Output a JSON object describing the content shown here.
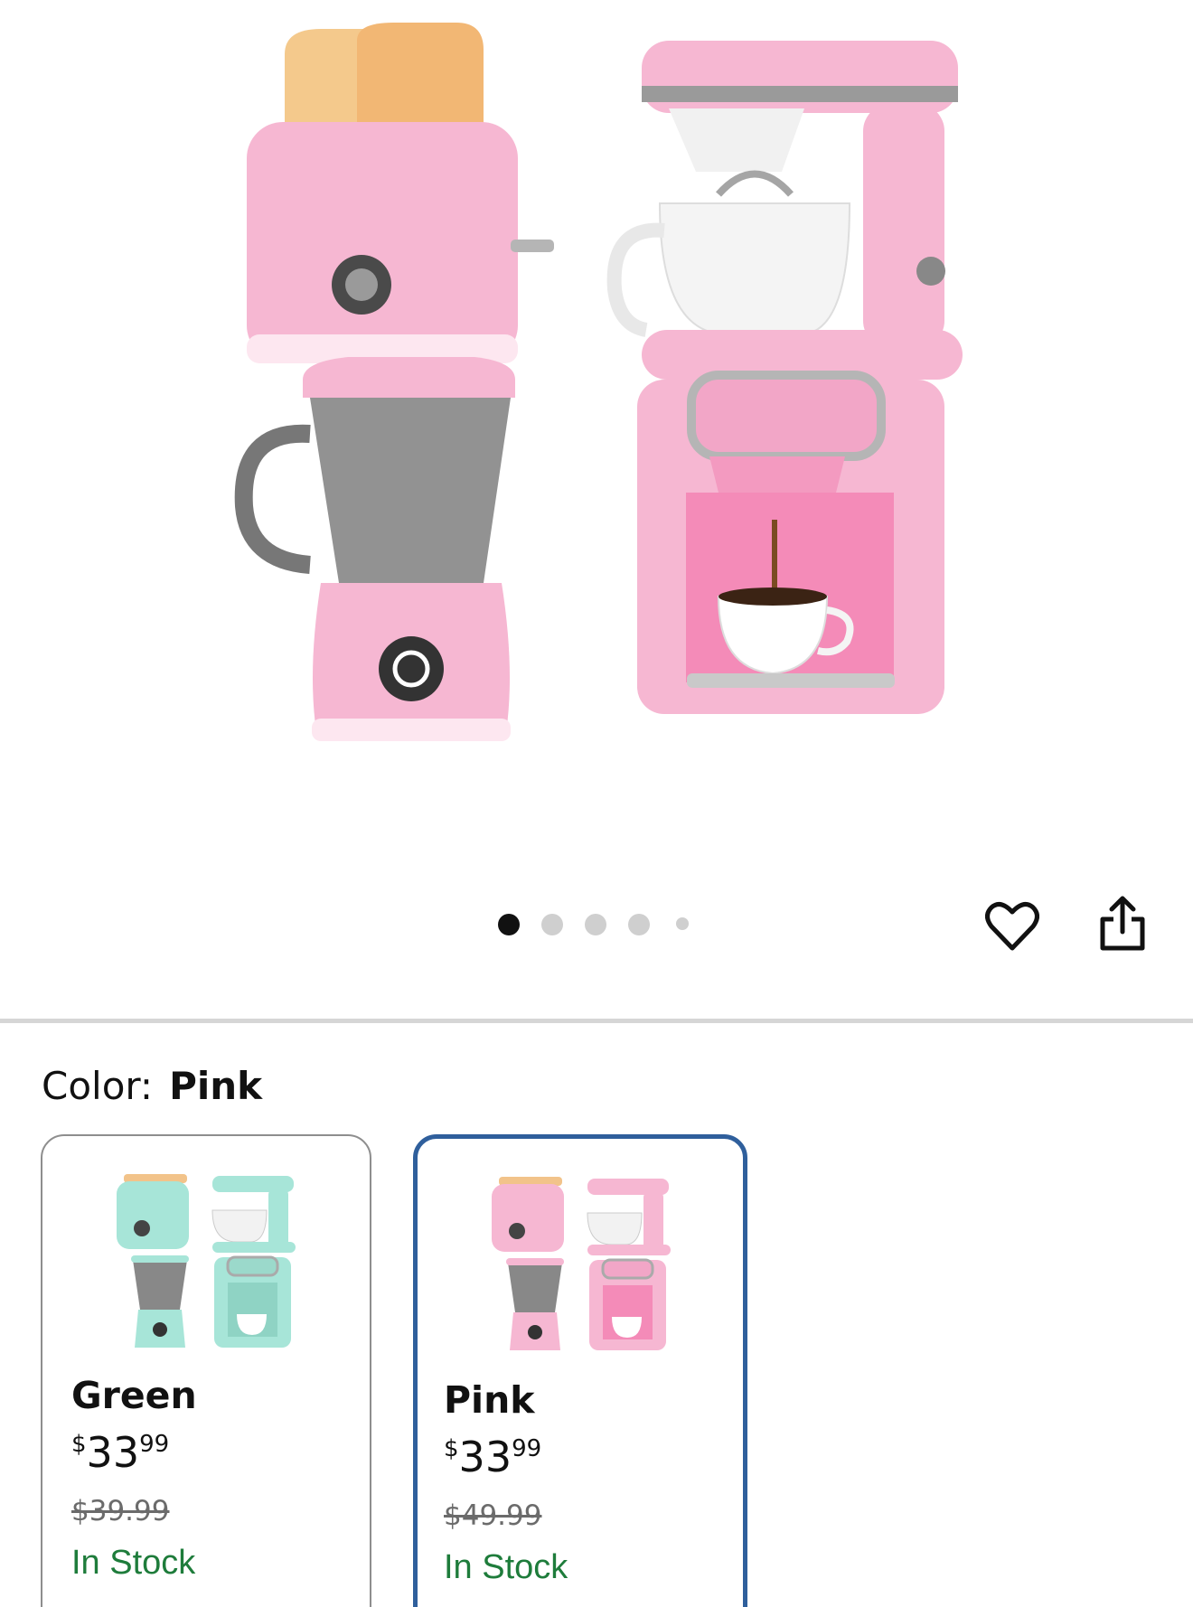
{
  "product_image": {
    "alt_icon": "kitchen-toys-photo",
    "accent": "#f6b7d2"
  },
  "carousel": {
    "total_dots": 5,
    "active_index": 0
  },
  "actions": {
    "favorite_icon": "heart-outline-icon",
    "share_icon": "share-icon"
  },
  "color_selector": {
    "label": "Color:",
    "selected": "Pink",
    "options": [
      {
        "name": "Green",
        "currency": "$",
        "whole": "33",
        "cents": "99",
        "old_price": "$39.99",
        "stock": "In Stock",
        "swatch_color": "#a7e5d8"
      },
      {
        "name": "Pink",
        "currency": "$",
        "whole": "33",
        "cents": "99",
        "old_price": "$49.99",
        "stock": "In Stock",
        "swatch_color": "#f6b7d2"
      }
    ]
  }
}
